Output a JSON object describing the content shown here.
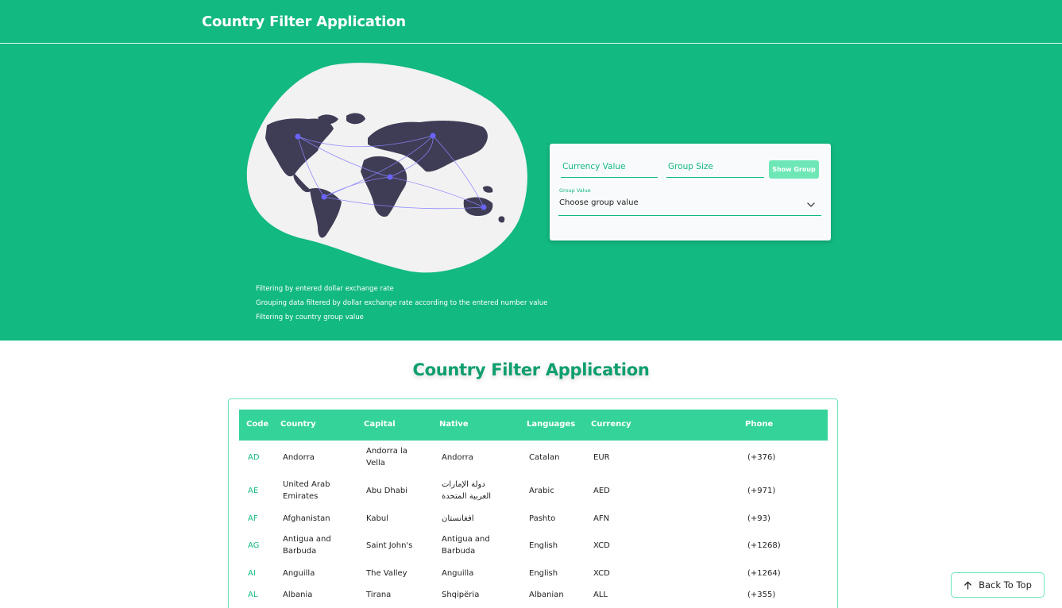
{
  "header": {
    "title": "Country Filter Application"
  },
  "hero": {
    "features": [
      "Filtering by entered dollar exchange rate",
      "Grouping data filtered by dollar exchange rate according to the entered number value",
      "Filtering by country group value"
    ]
  },
  "filters": {
    "currency_placeholder": "Currency Value",
    "group_size_placeholder": "Group Size",
    "show_group_label": "Show Group",
    "group_value_label": "Group Value",
    "group_value_selected": "Choose group value"
  },
  "section": {
    "title": "Country Filter Application"
  },
  "table": {
    "columns": [
      "Code",
      "Country",
      "Capital",
      "Native",
      "Languages",
      "Currency",
      "Phone"
    ],
    "rows": [
      {
        "code": "AD",
        "country": "Andorra",
        "capital": "Andorra la Vella",
        "native": "Andorra",
        "language": "Catalan",
        "currency": "EUR",
        "phone": "(+376)"
      },
      {
        "code": "AE",
        "country": "United Arab Emirates",
        "capital": "Abu Dhabi",
        "native": "دولة الإمارات العربية المتحدة",
        "language": "Arabic",
        "currency": "AED",
        "phone": "(+971)"
      },
      {
        "code": "AF",
        "country": "Afghanistan",
        "capital": "Kabul",
        "native": "افغانستان",
        "language": "Pashto",
        "currency": "AFN",
        "phone": "(+93)"
      },
      {
        "code": "AG",
        "country": "Antigua and Barbuda",
        "capital": "Saint John's",
        "native": "Antigua and Barbuda",
        "language": "English",
        "currency": "XCD",
        "phone": "(+1268)"
      },
      {
        "code": "AI",
        "country": "Anguilla",
        "capital": "The Valley",
        "native": "Anguilla",
        "language": "English",
        "currency": "XCD",
        "phone": "(+1264)"
      },
      {
        "code": "AL",
        "country": "Albania",
        "capital": "Tirana",
        "native": "Shqipëria",
        "language": "Albanian",
        "currency": "ALL",
        "phone": "(+355)"
      }
    ]
  },
  "back_to_top": {
    "label": "Back To Top"
  },
  "colors": {
    "primary": "#12b981",
    "header_row": "#34d399",
    "button": "#6ee7b7",
    "map": "#3f3d56",
    "map_dot": "#6c63ff"
  },
  "icons": {
    "map": "world-map-illustration",
    "select": "chevron-down-icon",
    "back_to_top": "arrow-up-icon"
  }
}
